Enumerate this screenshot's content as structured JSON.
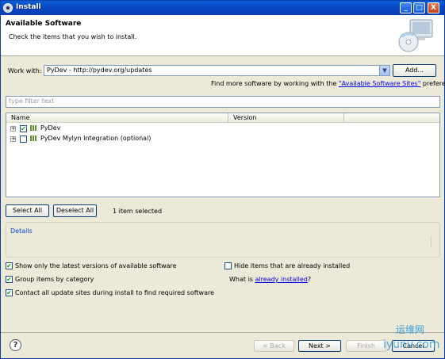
{
  "window": {
    "title": "Install",
    "controls": [
      "_",
      "□",
      "X"
    ]
  },
  "banner": {
    "heading": "Available Software",
    "subtitle": "Check the items that you wish to install."
  },
  "work_with": {
    "label": "Work with:",
    "value": "PyDev - http://pydev.org/updates",
    "add_button": "Add...",
    "more_text_prefix": "Find more software by working with the ",
    "more_link": "\"Available Software Sites\"",
    "more_text_suffix": " preferences."
  },
  "filter": {
    "placeholder": "type filter text"
  },
  "tree": {
    "columns": [
      "Name",
      "Version"
    ],
    "rows": [
      {
        "name": "PyDev",
        "version": "",
        "checked": true,
        "expander": "+"
      },
      {
        "name": "PyDev Mylyn Integration (optional)",
        "version": "",
        "checked": false,
        "expander": "+"
      }
    ]
  },
  "selection": {
    "select_all": "Select All",
    "deselect_all": "Deselect All",
    "status": "1 item selected"
  },
  "details": {
    "label": "Details"
  },
  "options": {
    "latest_only": {
      "label": "Show only the latest versions of available software",
      "checked": true
    },
    "group_by_category": {
      "label": "Group items by category",
      "checked": true
    },
    "contact_all_sites": {
      "label": "Contact all update sites during install to find required software",
      "checked": true
    },
    "hide_installed": {
      "label": "Hide items that are already installed",
      "checked": false
    },
    "what_is_prefix": "What is ",
    "already_installed_link": "already installed",
    "what_is_suffix": "?"
  },
  "footer": {
    "help": "?",
    "back": "< Back",
    "next": "Next >",
    "finish": "Finish",
    "cancel": "Cancel"
  },
  "watermark": {
    "line1": "运维网",
    "line2": "iyunv.com"
  },
  "colors": {
    "titlebar": "#0a48c4",
    "dialog_bg": "#ece9d8",
    "link": "#0000ee",
    "details_label": "#0046d5",
    "check": "#21a121"
  }
}
